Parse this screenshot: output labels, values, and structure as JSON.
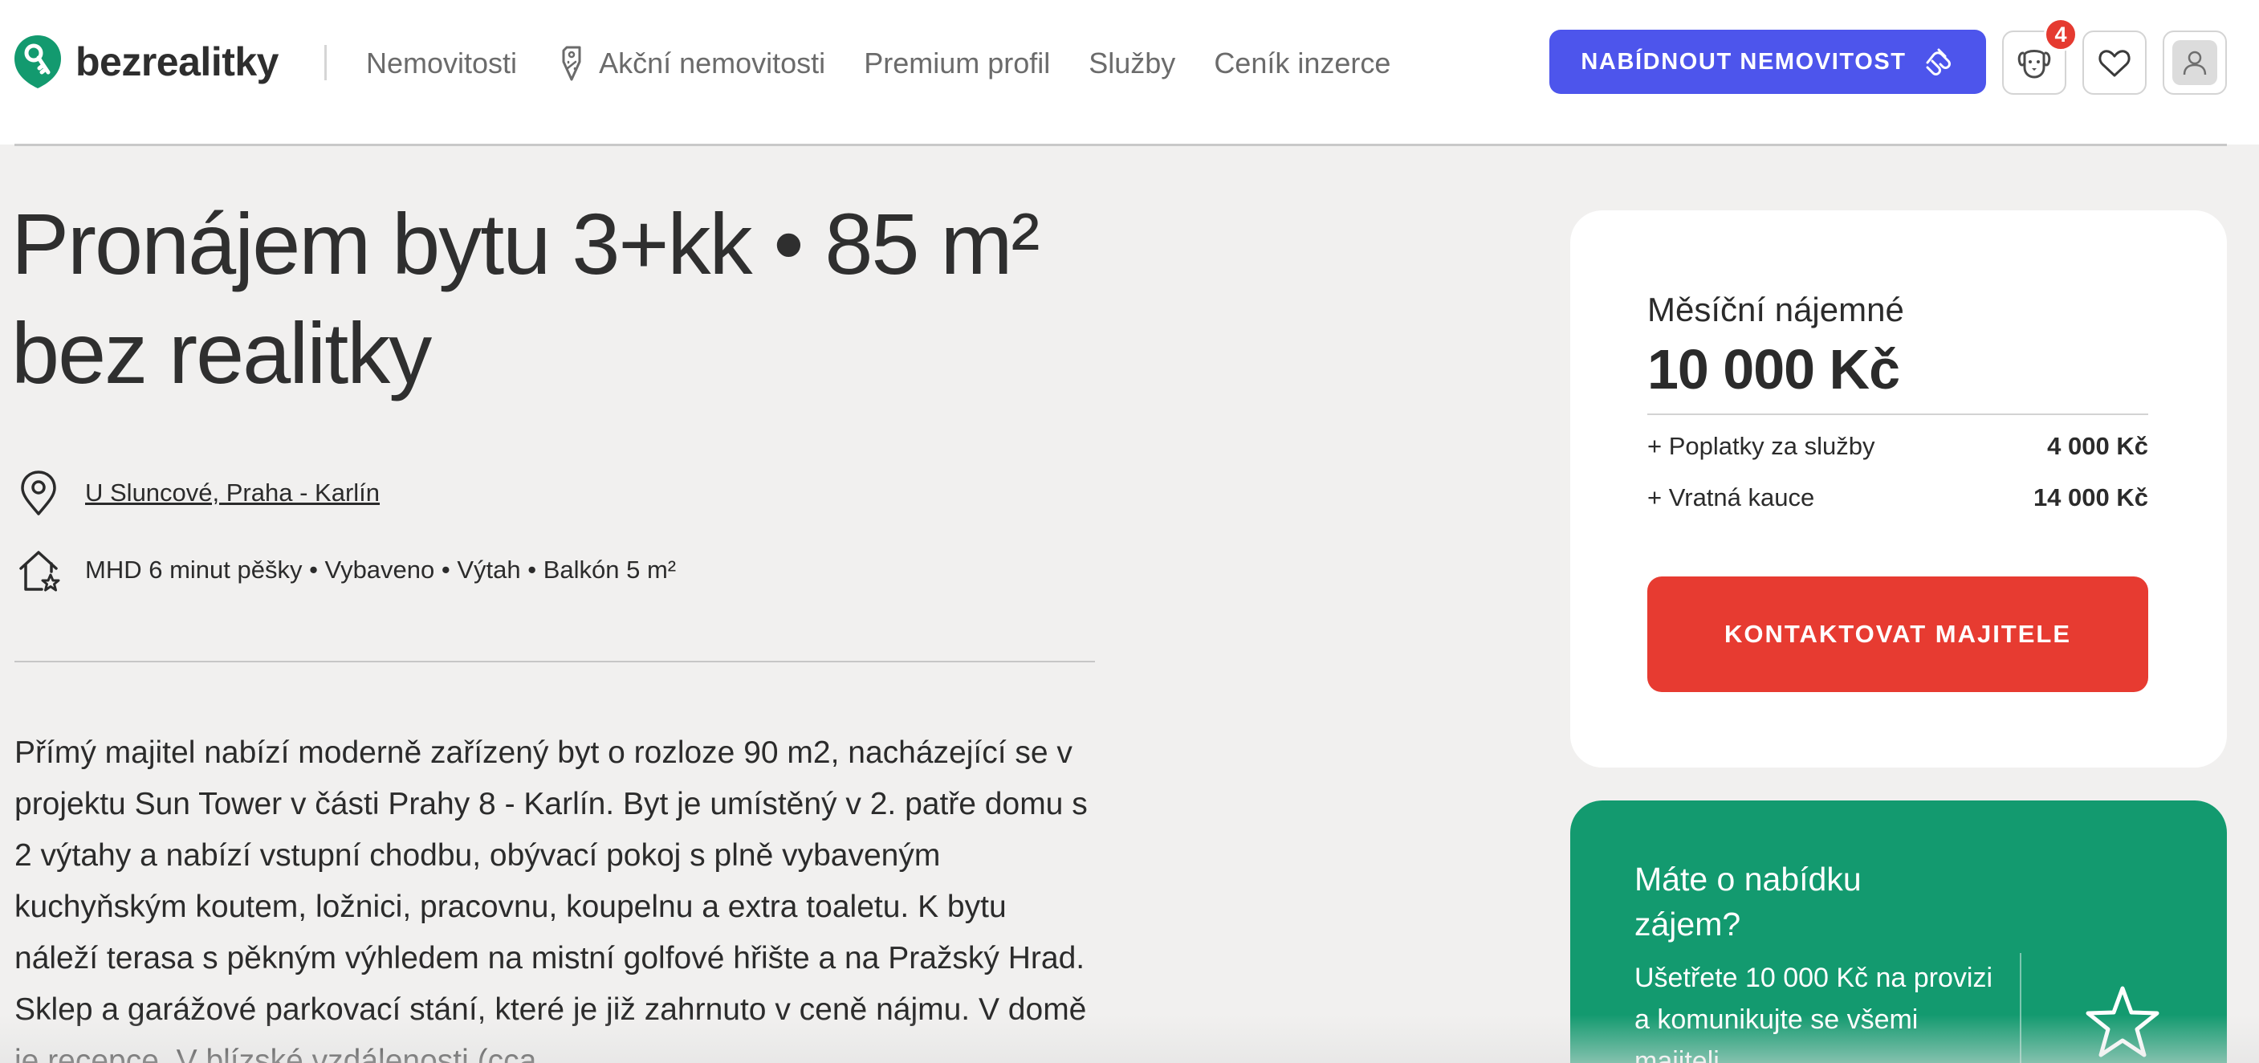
{
  "header": {
    "logo_text": "bezrealitky",
    "nav": [
      {
        "label": "Nemovitosti"
      },
      {
        "label": "Akční nemovitosti",
        "icon": "discount-tag-icon"
      },
      {
        "label": "Premium profil"
      },
      {
        "label": "Služby"
      },
      {
        "label": "Ceník inzerce"
      }
    ],
    "offer_button": "NABÍDNOUT NEMOVITOST",
    "notifications_badge": "4"
  },
  "listing": {
    "title_line1": "Pronájem bytu 3+kk • 85 m²",
    "title_line2": "bez realitky",
    "address": "U Sluncové, Praha - Karlín",
    "features": "MHD 6 minut pěšky • Vybaveno • Výtah • Balkón 5 m²",
    "description": "Přímý majitel nabízí moderně zařízený byt o rozloze 90 m2, nacházející se v projektu Sun Tower v části Prahy 8 - Karlín. Byt je umístěný v 2. patře domu s 2 výtahy a nabízí vstupní chodbu, obývací pokoj s plně vybaveným kuchyňským koutem, ložnici, pracovnu, koupelnu a extra toaletu. K bytu náleží terasa s pěkným výhledem na mistní golfové hřište a na Pražský Hrad. Sklep a garážové parkovací stání, které je již zahrnuto v ceně nájmu. V domě je recepce. V blízské vzdálenosti (cca"
  },
  "price_card": {
    "label": "Měsíční nájemné",
    "value": "10 000 Kč",
    "fees": [
      {
        "label": "+ Poplatky za služby",
        "amount": "4 000 Kč"
      },
      {
        "label": "+ Vratná kauce",
        "amount": "14 000 Kč"
      }
    ],
    "contact_button": "KONTAKTOVAT MAJITELE"
  },
  "promo_card": {
    "title": "Máte o nabídku zájem?",
    "text": "Ušetřete 10 000 Kč na provizi a komunikujte se všemi majiteli"
  },
  "colors": {
    "brand_green": "#139a6f",
    "primary_blue": "#4d55ec",
    "contact_red": "#e73b31",
    "badge_red": "#e53a30",
    "page_bg": "#f1f0ef"
  }
}
